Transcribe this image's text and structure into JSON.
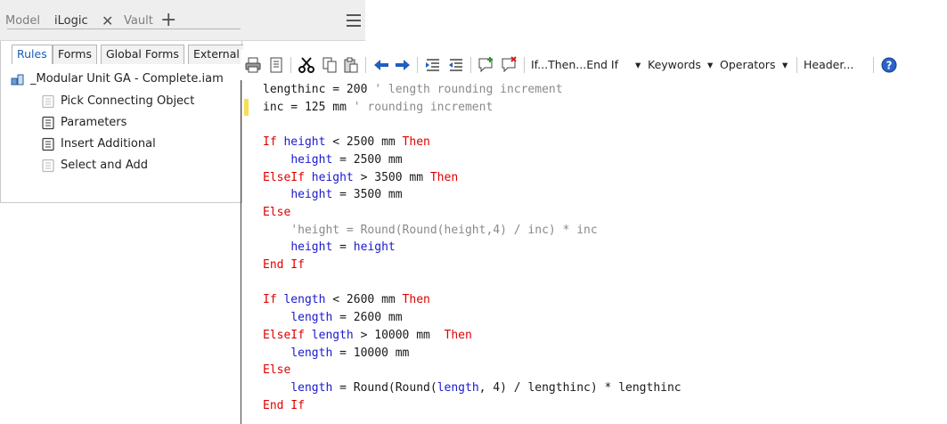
{
  "panel": {
    "tabs": [
      {
        "label": "Model"
      },
      {
        "label": "iLogic"
      },
      {
        "label": "Vault"
      }
    ],
    "subtabs": [
      {
        "label": "Rules"
      },
      {
        "label": "Forms"
      },
      {
        "label": "Global Forms"
      },
      {
        "label": "External Rules"
      }
    ],
    "tree": {
      "root": "_Modular Unit GA - Complete.iam",
      "items": [
        {
          "label": "Pick Connecting Object"
        },
        {
          "label": "Parameters"
        },
        {
          "label": "Insert Additional"
        },
        {
          "label": "Select and Add"
        }
      ]
    }
  },
  "toolbar": {
    "menus": [
      {
        "label": "If...Then...End If"
      },
      {
        "label": "Keywords"
      },
      {
        "label": "Operators"
      },
      {
        "label": "Header..."
      }
    ]
  },
  "editor": {
    "lines": [
      [
        [
          "pl",
          "lengthinc = 200 "
        ],
        [
          "cm",
          "' length rounding increment"
        ]
      ],
      [
        [
          "pl",
          "inc = 125 mm "
        ],
        [
          "cm",
          "' rounding increment"
        ]
      ],
      [],
      [
        [
          "kw",
          "If "
        ],
        [
          "var",
          "height"
        ],
        [
          "pl",
          " < 2500 mm "
        ],
        [
          "kw",
          "Then"
        ]
      ],
      [
        [
          "pl",
          "    "
        ],
        [
          "var",
          "height"
        ],
        [
          "pl",
          " = 2500 mm"
        ]
      ],
      [
        [
          "kw",
          "ElseIf "
        ],
        [
          "var",
          "height"
        ],
        [
          "pl",
          " > 3500 mm "
        ],
        [
          "kw",
          "Then"
        ]
      ],
      [
        [
          "pl",
          "    "
        ],
        [
          "var",
          "height"
        ],
        [
          "pl",
          " = 3500 mm"
        ]
      ],
      [
        [
          "kw",
          "Else"
        ]
      ],
      [
        [
          "pl",
          "    "
        ],
        [
          "cm",
          "'height = Round(Round(height,4) / inc) * inc"
        ]
      ],
      [
        [
          "pl",
          "    "
        ],
        [
          "var",
          "height"
        ],
        [
          "pl",
          " = "
        ],
        [
          "var",
          "height"
        ]
      ],
      [
        [
          "kw",
          "End If"
        ]
      ],
      [],
      [
        [
          "kw",
          "If "
        ],
        [
          "var",
          "length"
        ],
        [
          "pl",
          " < 2600 mm "
        ],
        [
          "kw",
          "Then"
        ]
      ],
      [
        [
          "pl",
          "    "
        ],
        [
          "var",
          "length"
        ],
        [
          "pl",
          " = 2600 mm"
        ]
      ],
      [
        [
          "kw",
          "ElseIf "
        ],
        [
          "var",
          "length"
        ],
        [
          "pl",
          " > 10000 mm  "
        ],
        [
          "kw",
          "Then"
        ]
      ],
      [
        [
          "pl",
          "    "
        ],
        [
          "var",
          "length"
        ],
        [
          "pl",
          " = 10000 mm"
        ]
      ],
      [
        [
          "kw",
          "Else"
        ]
      ],
      [
        [
          "pl",
          "    "
        ],
        [
          "var",
          "length"
        ],
        [
          "pl",
          " = Round(Round("
        ],
        [
          "var",
          "length"
        ],
        [
          "pl",
          ", 4) / lengthinc) * lengthinc"
        ]
      ],
      [
        [
          "kw",
          "End If"
        ]
      ]
    ]
  }
}
